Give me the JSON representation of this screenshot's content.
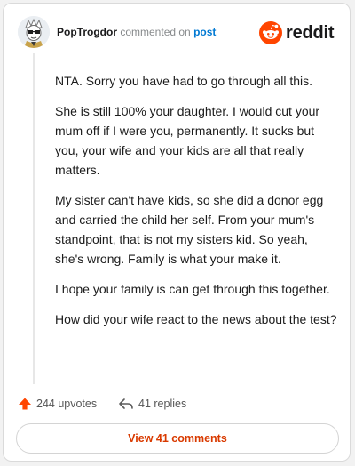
{
  "header": {
    "username": "PopTrogdor",
    "commented_text": "commented on",
    "post_link": "post",
    "logo_icon": "reddit-logo-icon",
    "logo_text": "reddit"
  },
  "comment": {
    "paragraphs": [
      "NTA. Sorry you have had to go through all this.",
      "She is still 100% your daughter. I would cut your mum off if I were you, permanently. It sucks but you, your wife and your kids are all that really matters.",
      "My sister can't have kids, so she did a donor egg and carried the child her self. From your mum's standpoint, that is not my sisters kid. So yeah, she's wrong. Family is what your make it.",
      "I hope your family is can get through this together.",
      "How did your wife react to the news about the test?"
    ]
  },
  "actions": {
    "upvotes": "244 upvotes",
    "upvote_icon": "upvote-arrow-icon",
    "replies": "41 replies",
    "reply_icon": "reply-arrow-icon"
  },
  "footer": {
    "view_comments": "View 41 comments"
  },
  "colors": {
    "accent": "#ff4500",
    "link": "#0079d3",
    "button_text": "#d93a00"
  }
}
